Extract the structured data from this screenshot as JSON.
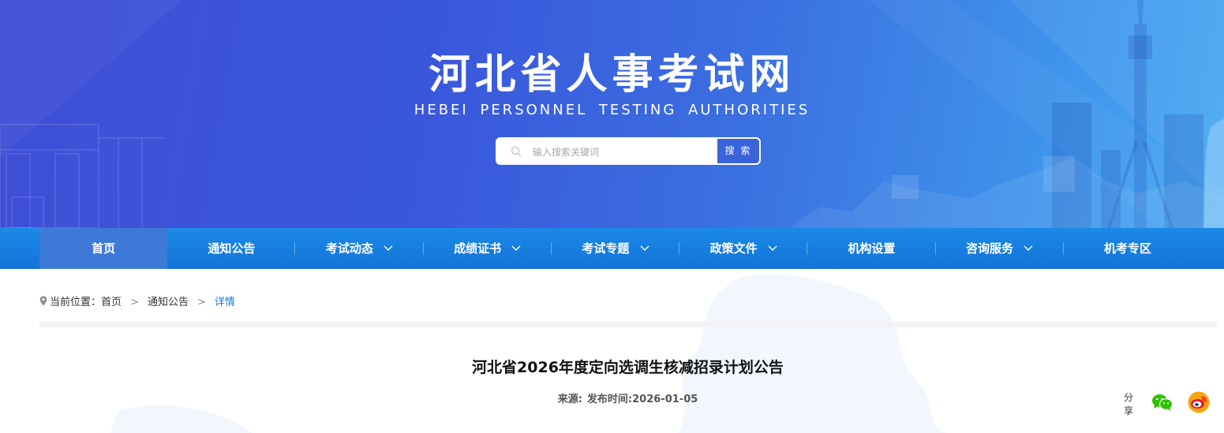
{
  "header": {
    "site_title": "河北省人事考试网",
    "site_subtitle": "HEBEI PERSONNEL TESTING AUTHORITIES",
    "search": {
      "placeholder": "输入搜索关键词",
      "value": "",
      "button_label": "搜 索"
    }
  },
  "nav": {
    "items": [
      {
        "label": "首页",
        "has_dropdown": false,
        "active": true
      },
      {
        "label": "通知公告",
        "has_dropdown": false,
        "active": false
      },
      {
        "label": "考试动态",
        "has_dropdown": true,
        "active": false
      },
      {
        "label": "成绩证书",
        "has_dropdown": true,
        "active": false
      },
      {
        "label": "考试专题",
        "has_dropdown": true,
        "active": false
      },
      {
        "label": "政策文件",
        "has_dropdown": true,
        "active": false
      },
      {
        "label": "机构设置",
        "has_dropdown": false,
        "active": false
      },
      {
        "label": "咨询服务",
        "has_dropdown": true,
        "active": false
      },
      {
        "label": "机考专区",
        "has_dropdown": false,
        "active": false
      }
    ]
  },
  "breadcrumb": {
    "prefix": "当前位置：",
    "items": [
      "首页",
      "通知公告",
      "详情"
    ],
    "separator": ">"
  },
  "article": {
    "title": "河北省2026年度定向选调生核减招录计划公告",
    "source_label": "来源:",
    "source_value": "",
    "published_label": "发布时间:",
    "published_value": "2026-01-05"
  },
  "share": {
    "label": "分享",
    "icons": [
      "wechat-icon",
      "weibo-icon"
    ]
  },
  "colors": {
    "banner_left": "#3f4fd6",
    "banner_right": "#49aaf2",
    "nav_bg": "#1273d8",
    "nav_active": "#3d7ad8",
    "breadcrumb_current": "#1a73d6",
    "wechat_green": "#2dc100",
    "weibo_orange": "#f7a30e",
    "weibo_red": "#e6162d"
  }
}
